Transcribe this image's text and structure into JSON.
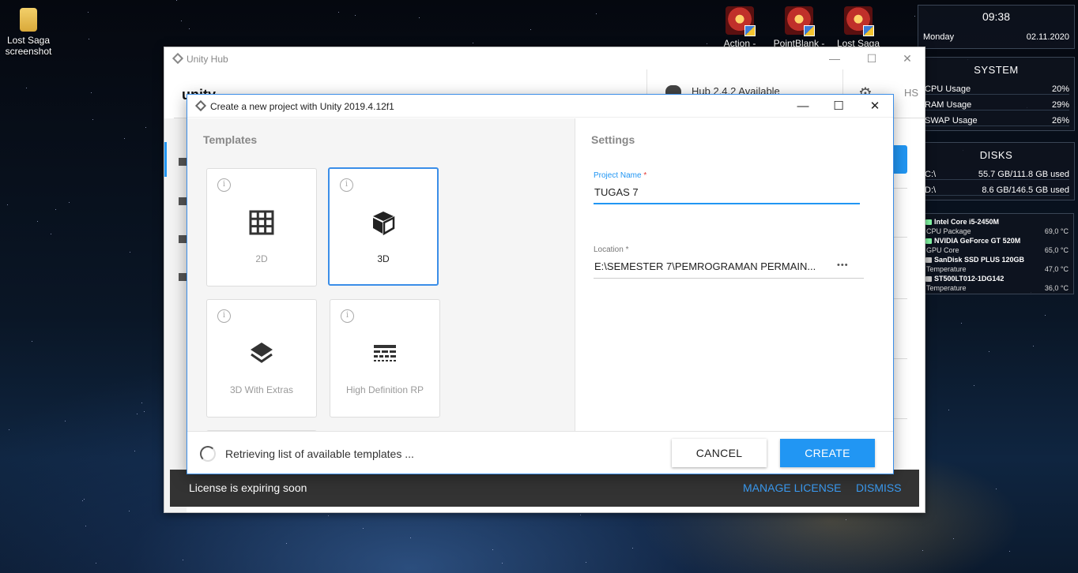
{
  "desktop": {
    "icons": [
      {
        "label_line1": "Lost Saga",
        "label_line2": "screenshot",
        "icon": "folder-icon"
      },
      {
        "label_line1": "Action -",
        "icon": "game-shortcut-icon"
      },
      {
        "label_line1": "PointBlank -",
        "icon": "game-shortcut-icon"
      },
      {
        "label_line1": "Lost Saga",
        "icon": "game-shortcut-icon"
      }
    ]
  },
  "widget": {
    "time": "09:38",
    "day": "Monday",
    "date": "02.11.2020",
    "system_title": "SYSTEM",
    "system_rows": [
      {
        "label": "CPU Usage",
        "value": "20%"
      },
      {
        "label": "RAM Usage",
        "value": "29%"
      },
      {
        "label": "SWAP Usage",
        "value": "26%"
      }
    ],
    "disks_title": "DISKS",
    "disk_rows": [
      {
        "label": "C:\\",
        "value": "55.7 GB/111.8 GB used"
      },
      {
        "label": "D:\\",
        "value": "8.6 GB/146.5 GB used"
      }
    ],
    "hardware": [
      {
        "name": "Intel Core i5-2450M",
        "sensor": "CPU Package",
        "value": "69,0 °C"
      },
      {
        "name": "NVIDIA GeForce GT 520M",
        "sensor": "GPU Core",
        "value": "65,0 °C"
      },
      {
        "name": "SanDisk SSD PLUS 120GB",
        "sensor": "Temperature",
        "value": "47,0 °C"
      },
      {
        "name": "ST500LT012-1DG142",
        "sensor": "Temperature",
        "value": "36,0 °C"
      }
    ]
  },
  "hub": {
    "title": "Unity Hub",
    "logo": "unity",
    "update_text": "Hub 2.4.2 Available",
    "user_initials": "HS",
    "accent": "#2196f3"
  },
  "license": {
    "message": "License is expiring soon",
    "manage": "MANAGE LICENSE",
    "dismiss": "DISMISS"
  },
  "dialog": {
    "title": "Create a new project with Unity 2019.4.12f1",
    "templates_heading": "Templates",
    "settings_heading": "Settings",
    "templates": [
      {
        "label": "2D",
        "icon": "grid-icon",
        "selected": false
      },
      {
        "label": "3D",
        "icon": "cube-icon",
        "selected": true
      },
      {
        "label": "3D With Extras",
        "icon": "layers-icon",
        "selected": false
      },
      {
        "label": "High Definition RP",
        "icon": "hdrp-icon",
        "selected": false
      }
    ],
    "project_name_label": "Project Name",
    "project_name_value": "TUGAS 7",
    "location_label": "Location",
    "location_value": "E:\\SEMESTER 7\\PEMROGRAMAN PERMAIN...",
    "browse_glyph": "•••",
    "footer_msg": "Retrieving list of available templates ...",
    "cancel": "CANCEL",
    "create": "CREATE"
  }
}
